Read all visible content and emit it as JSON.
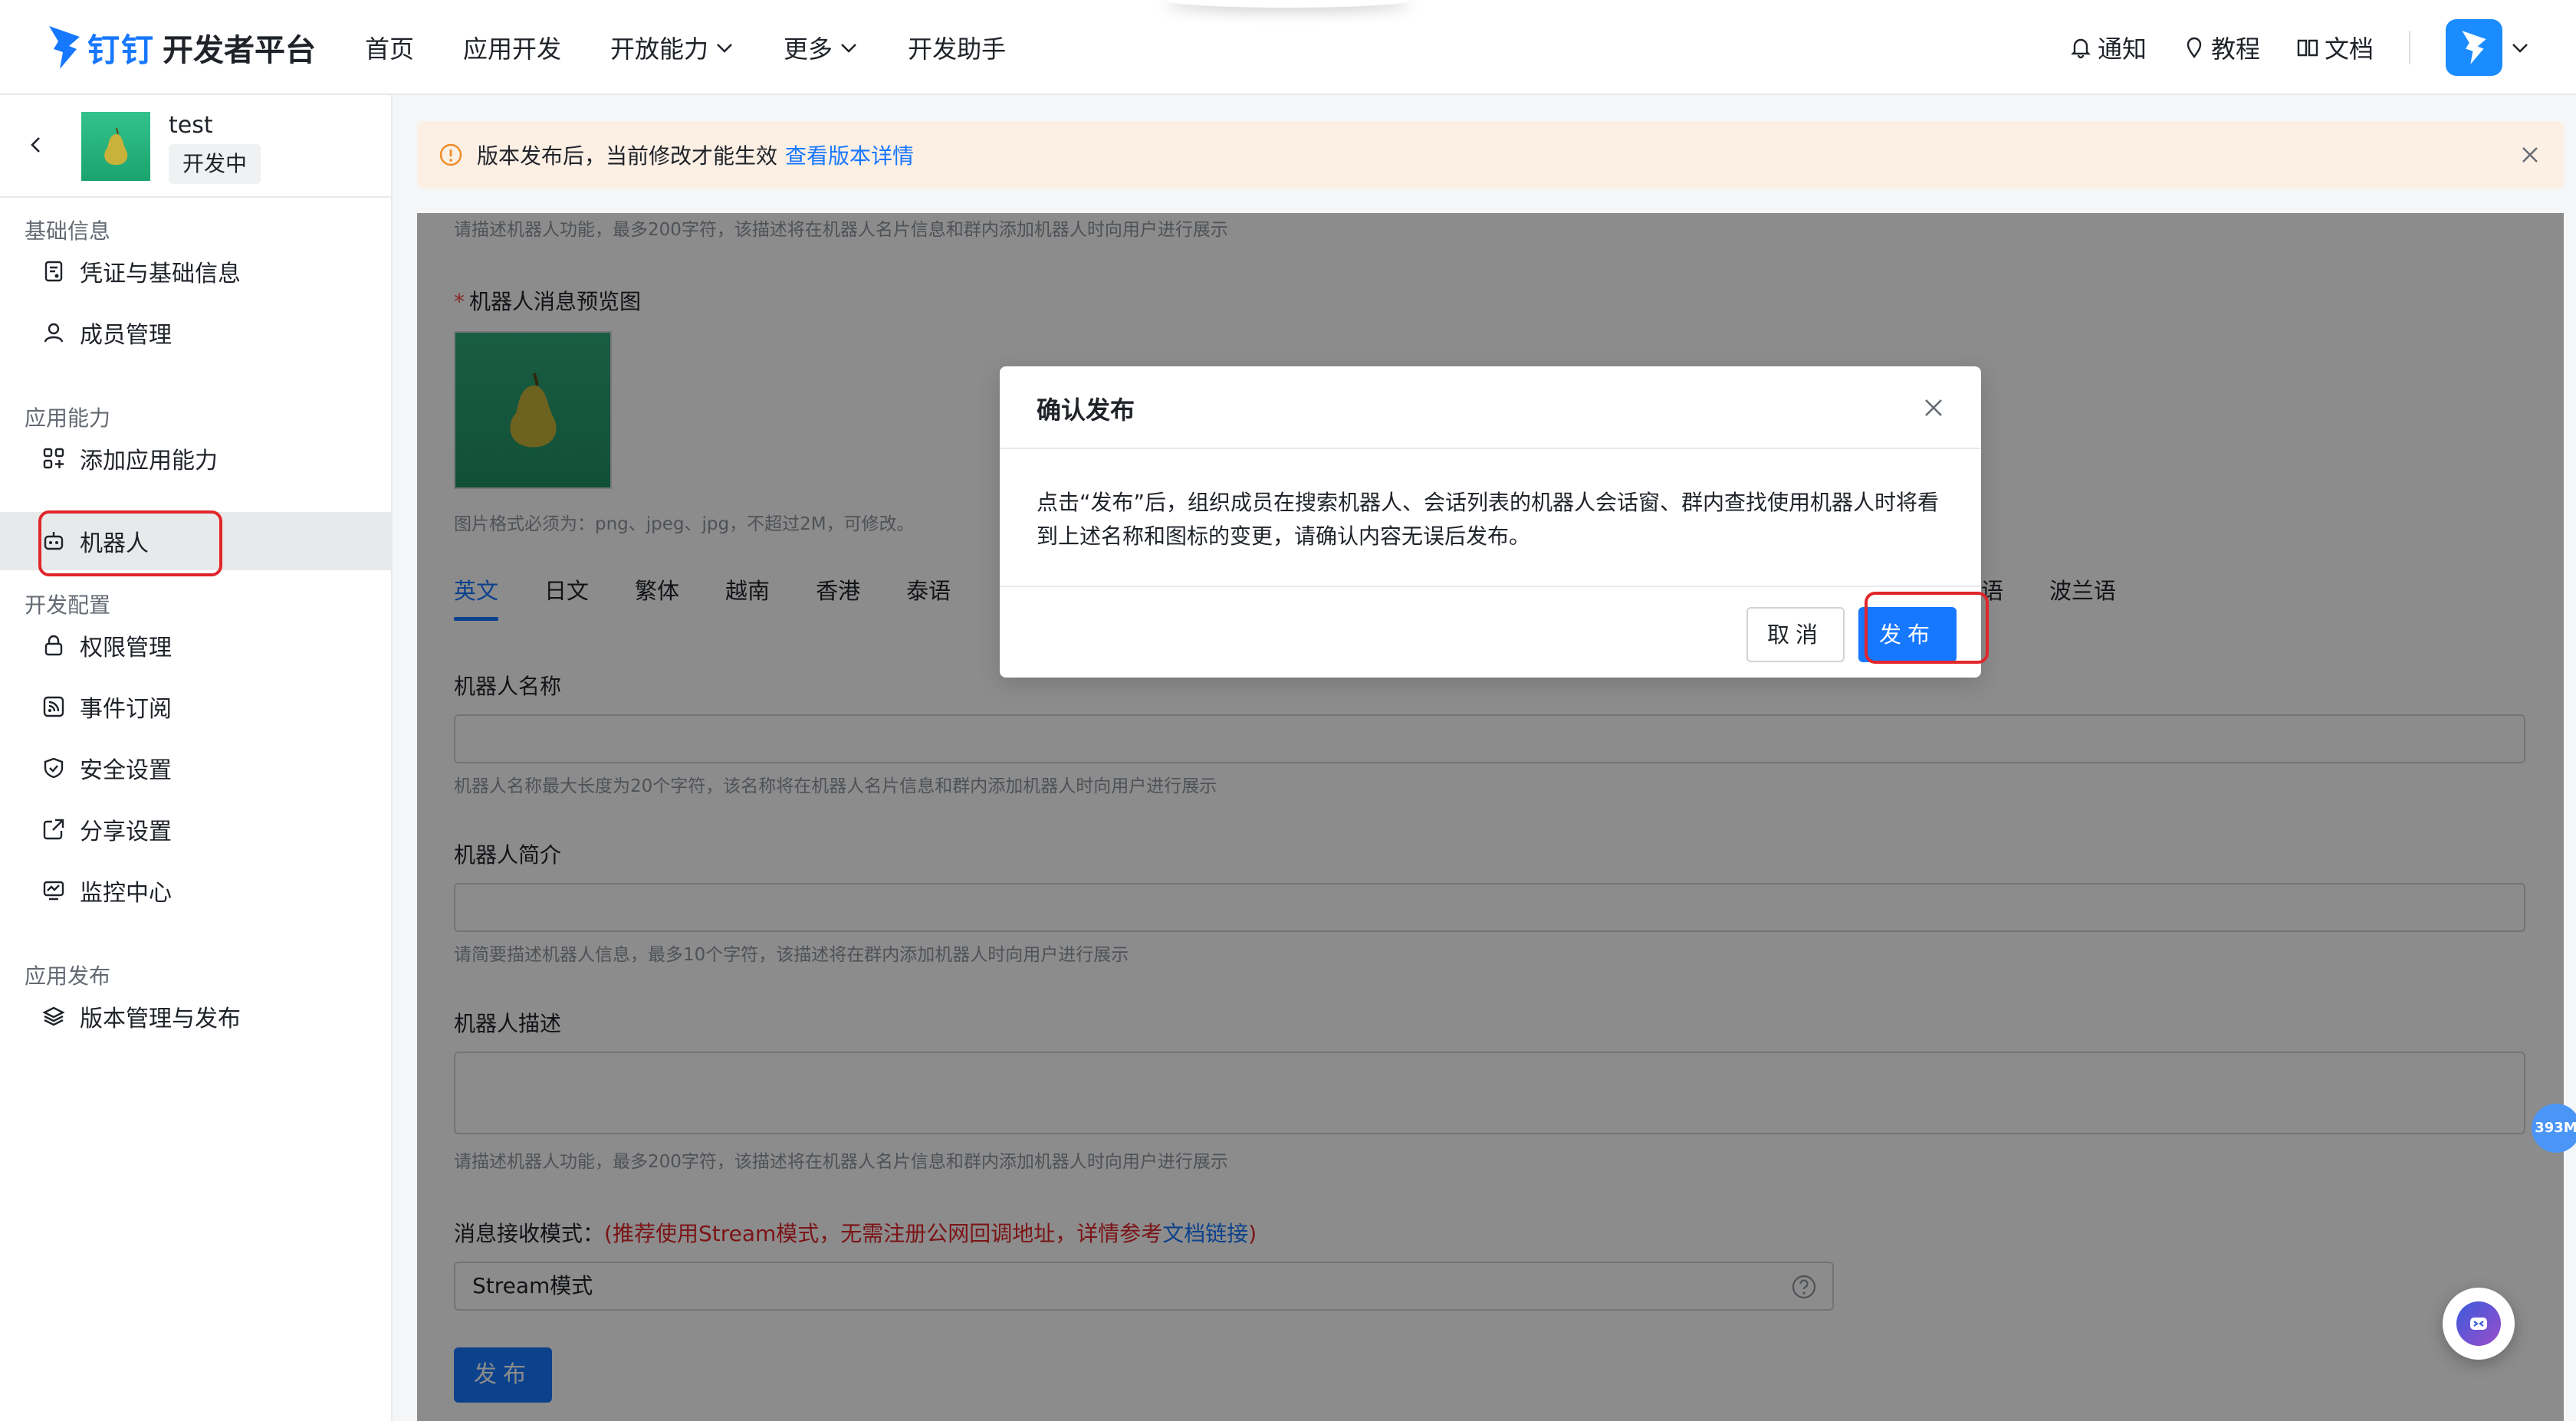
{
  "brand": {
    "name": "钉钉",
    "subtitle": "开发者平台"
  },
  "nav": {
    "items": [
      {
        "label": "首页",
        "dropdown": false
      },
      {
        "label": "应用开发",
        "dropdown": false
      },
      {
        "label": "开放能力",
        "dropdown": true
      },
      {
        "label": "更多",
        "dropdown": true
      },
      {
        "label": "开发助手",
        "dropdown": false
      }
    ],
    "right": {
      "notify": "通知",
      "tutorial": "教程",
      "docs": "文档"
    }
  },
  "app": {
    "name": "test",
    "status": "开发中"
  },
  "sidebar": {
    "groups": [
      {
        "title": "基础信息",
        "items": [
          {
            "label": "凭证与基础信息",
            "icon": "credential-icon"
          },
          {
            "label": "成员管理",
            "icon": "user-icon"
          }
        ]
      },
      {
        "title": "应用能力",
        "items": [
          {
            "label": "添加应用能力",
            "icon": "apps-icon"
          },
          {
            "label": "机器人",
            "icon": "robot-icon",
            "active": true
          }
        ]
      },
      {
        "title": "开发配置",
        "items": [
          {
            "label": "权限管理",
            "icon": "lock-icon"
          },
          {
            "label": "事件订阅",
            "icon": "rss-icon"
          },
          {
            "label": "安全设置",
            "icon": "shield-icon"
          },
          {
            "label": "分享设置",
            "icon": "share-icon"
          },
          {
            "label": "监控中心",
            "icon": "monitor-icon"
          }
        ]
      },
      {
        "title": "应用发布",
        "items": [
          {
            "label": "版本管理与发布",
            "icon": "layers-icon"
          }
        ]
      }
    ]
  },
  "notice": {
    "text": "版本发布后，当前修改才能生效",
    "link": "查看版本详情"
  },
  "form": {
    "desc_hint_top": "请描述机器人功能，最多200字符，该描述将在机器人名片信息和群内添加机器人时向用户进行展示",
    "preview_label": "机器人消息预览图",
    "preview_hint": "图片格式必须为：png、jpeg、jpg，不超过2M，可修改。",
    "tabs": [
      "英文",
      "日文",
      "繁体",
      "越南",
      "香港",
      "泰语"
    ],
    "tabs_right": [
      "语",
      "波兰语"
    ],
    "name_label": "机器人名称",
    "name_hint": "机器人名称最大长度为20个字符，该名称将在机器人名片信息和群内添加机器人时向用户进行展示",
    "intro_label": "机器人简介",
    "intro_hint": "请简要描述机器人信息，最多10个字符，该描述将在群内添加机器人时向用户进行展示",
    "desc_label": "机器人描述",
    "desc_hint": "请描述机器人功能，最多200字符，该描述将在机器人名片信息和群内添加机器人时向用户进行展示",
    "mode_label": "消息接收模式：",
    "mode_note": "(推荐使用Stream模式，无需注册公网回调地址，详情参考",
    "mode_link": "文档链接",
    "mode_close": ")",
    "mode_value": "Stream模式",
    "publish_label": "发布"
  },
  "modal": {
    "title": "确认发布",
    "body_line1": "点击“发布”后，组织成员在搜索机器人、会话列表的机器人会话窗、群内查找使用机器人时将看",
    "body_line2": "到上述名称和图标的变更，请确认内容无误后发布。",
    "cancel": "取消",
    "confirm": "发布"
  },
  "float": {
    "badge": "393M"
  },
  "colors": {
    "primary": "#1677ff",
    "danger": "#e0262a",
    "notice_bg": "#fcefe4"
  }
}
